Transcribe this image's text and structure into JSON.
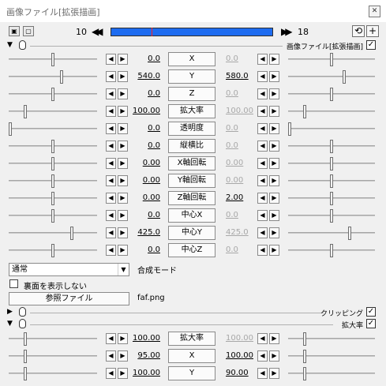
{
  "window": {
    "title": "画像ファイル[拡張描画]",
    "close_icon": "close-icon"
  },
  "timeline": {
    "start_frame": "10",
    "end_frame": "18",
    "cursor_fraction": 0.25,
    "bar_color": "#1e6cf0",
    "cursor_color": "#ff2020",
    "left_icons": [
      "camera-icon",
      "screen-icon"
    ],
    "rewind_icon": "rewind-icon",
    "forward_icon": "fast-forward-icon",
    "reset_icon": "reset-icon",
    "add_icon": "add-icon"
  },
  "main_section": {
    "label": "画像ファイル[拡張描画]",
    "enabled": true
  },
  "params": [
    {
      "name": "X",
      "start": "0.0",
      "end": "0.0",
      "end_dim": true,
      "l": 0.5,
      "r": 0.5
    },
    {
      "name": "Y",
      "start": "540.0",
      "end": "580.0",
      "end_dim": false,
      "l": 0.6,
      "r": 0.65
    },
    {
      "name": "Z",
      "start": "0.0",
      "end": "0.0",
      "end_dim": true,
      "l": 0.5,
      "r": 0.5
    },
    {
      "name": "拡大率",
      "start": "100.00",
      "end": "100.00",
      "end_dim": true,
      "l": 0.18,
      "r": 0.18
    },
    {
      "name": "透明度",
      "start": "0.0",
      "end": "0.0",
      "end_dim": true,
      "l": 0.0,
      "r": 0.0
    },
    {
      "name": "縦横比",
      "start": "0.0",
      "end": "0.0",
      "end_dim": true,
      "l": 0.5,
      "r": 0.5
    },
    {
      "name": "X軸回転",
      "start": "0.00",
      "end": "0.00",
      "end_dim": true,
      "l": 0.5,
      "r": 0.5
    },
    {
      "name": "Y軸回転",
      "start": "0.00",
      "end": "0.00",
      "end_dim": true,
      "l": 0.5,
      "r": 0.5
    },
    {
      "name": "Z軸回転",
      "start": "0.00",
      "end": "2.00",
      "end_dim": false,
      "l": 0.5,
      "r": 0.5
    },
    {
      "name": "中心X",
      "start": "0.0",
      "end": "0.0",
      "end_dim": true,
      "l": 0.5,
      "r": 0.5
    },
    {
      "name": "中心Y",
      "start": "425.0",
      "end": "425.0",
      "end_dim": true,
      "l": 0.72,
      "r": 0.72
    },
    {
      "name": "中心Z",
      "start": "0.0",
      "end": "0.0",
      "end_dim": true,
      "l": 0.5,
      "r": 0.5
    }
  ],
  "blend": {
    "selected": "通常",
    "label": "合成モード"
  },
  "hide_back": {
    "label": "裏面を表示しない",
    "checked": false
  },
  "file": {
    "button_label": "参照ファイル",
    "filename": "faf.png"
  },
  "clipping_section": {
    "label": "クリッピング",
    "enabled": true
  },
  "scale_section": {
    "label": "拡大率",
    "enabled": true
  },
  "scale_params": [
    {
      "name": "拡大率",
      "start": "100.00",
      "end": "100.00",
      "end_dim": true,
      "l": 0.18,
      "r": 0.18
    },
    {
      "name": "X",
      "start": "95.00",
      "end": "100.00",
      "end_dim": false,
      "l": 0.18,
      "r": 0.18
    },
    {
      "name": "Y",
      "start": "100.00",
      "end": "90.00",
      "end_dim": false,
      "l": 0.18,
      "r": 0.18
    }
  ],
  "arrows": {
    "left": "◀",
    "right": "▶"
  },
  "check_glyph": "✓"
}
